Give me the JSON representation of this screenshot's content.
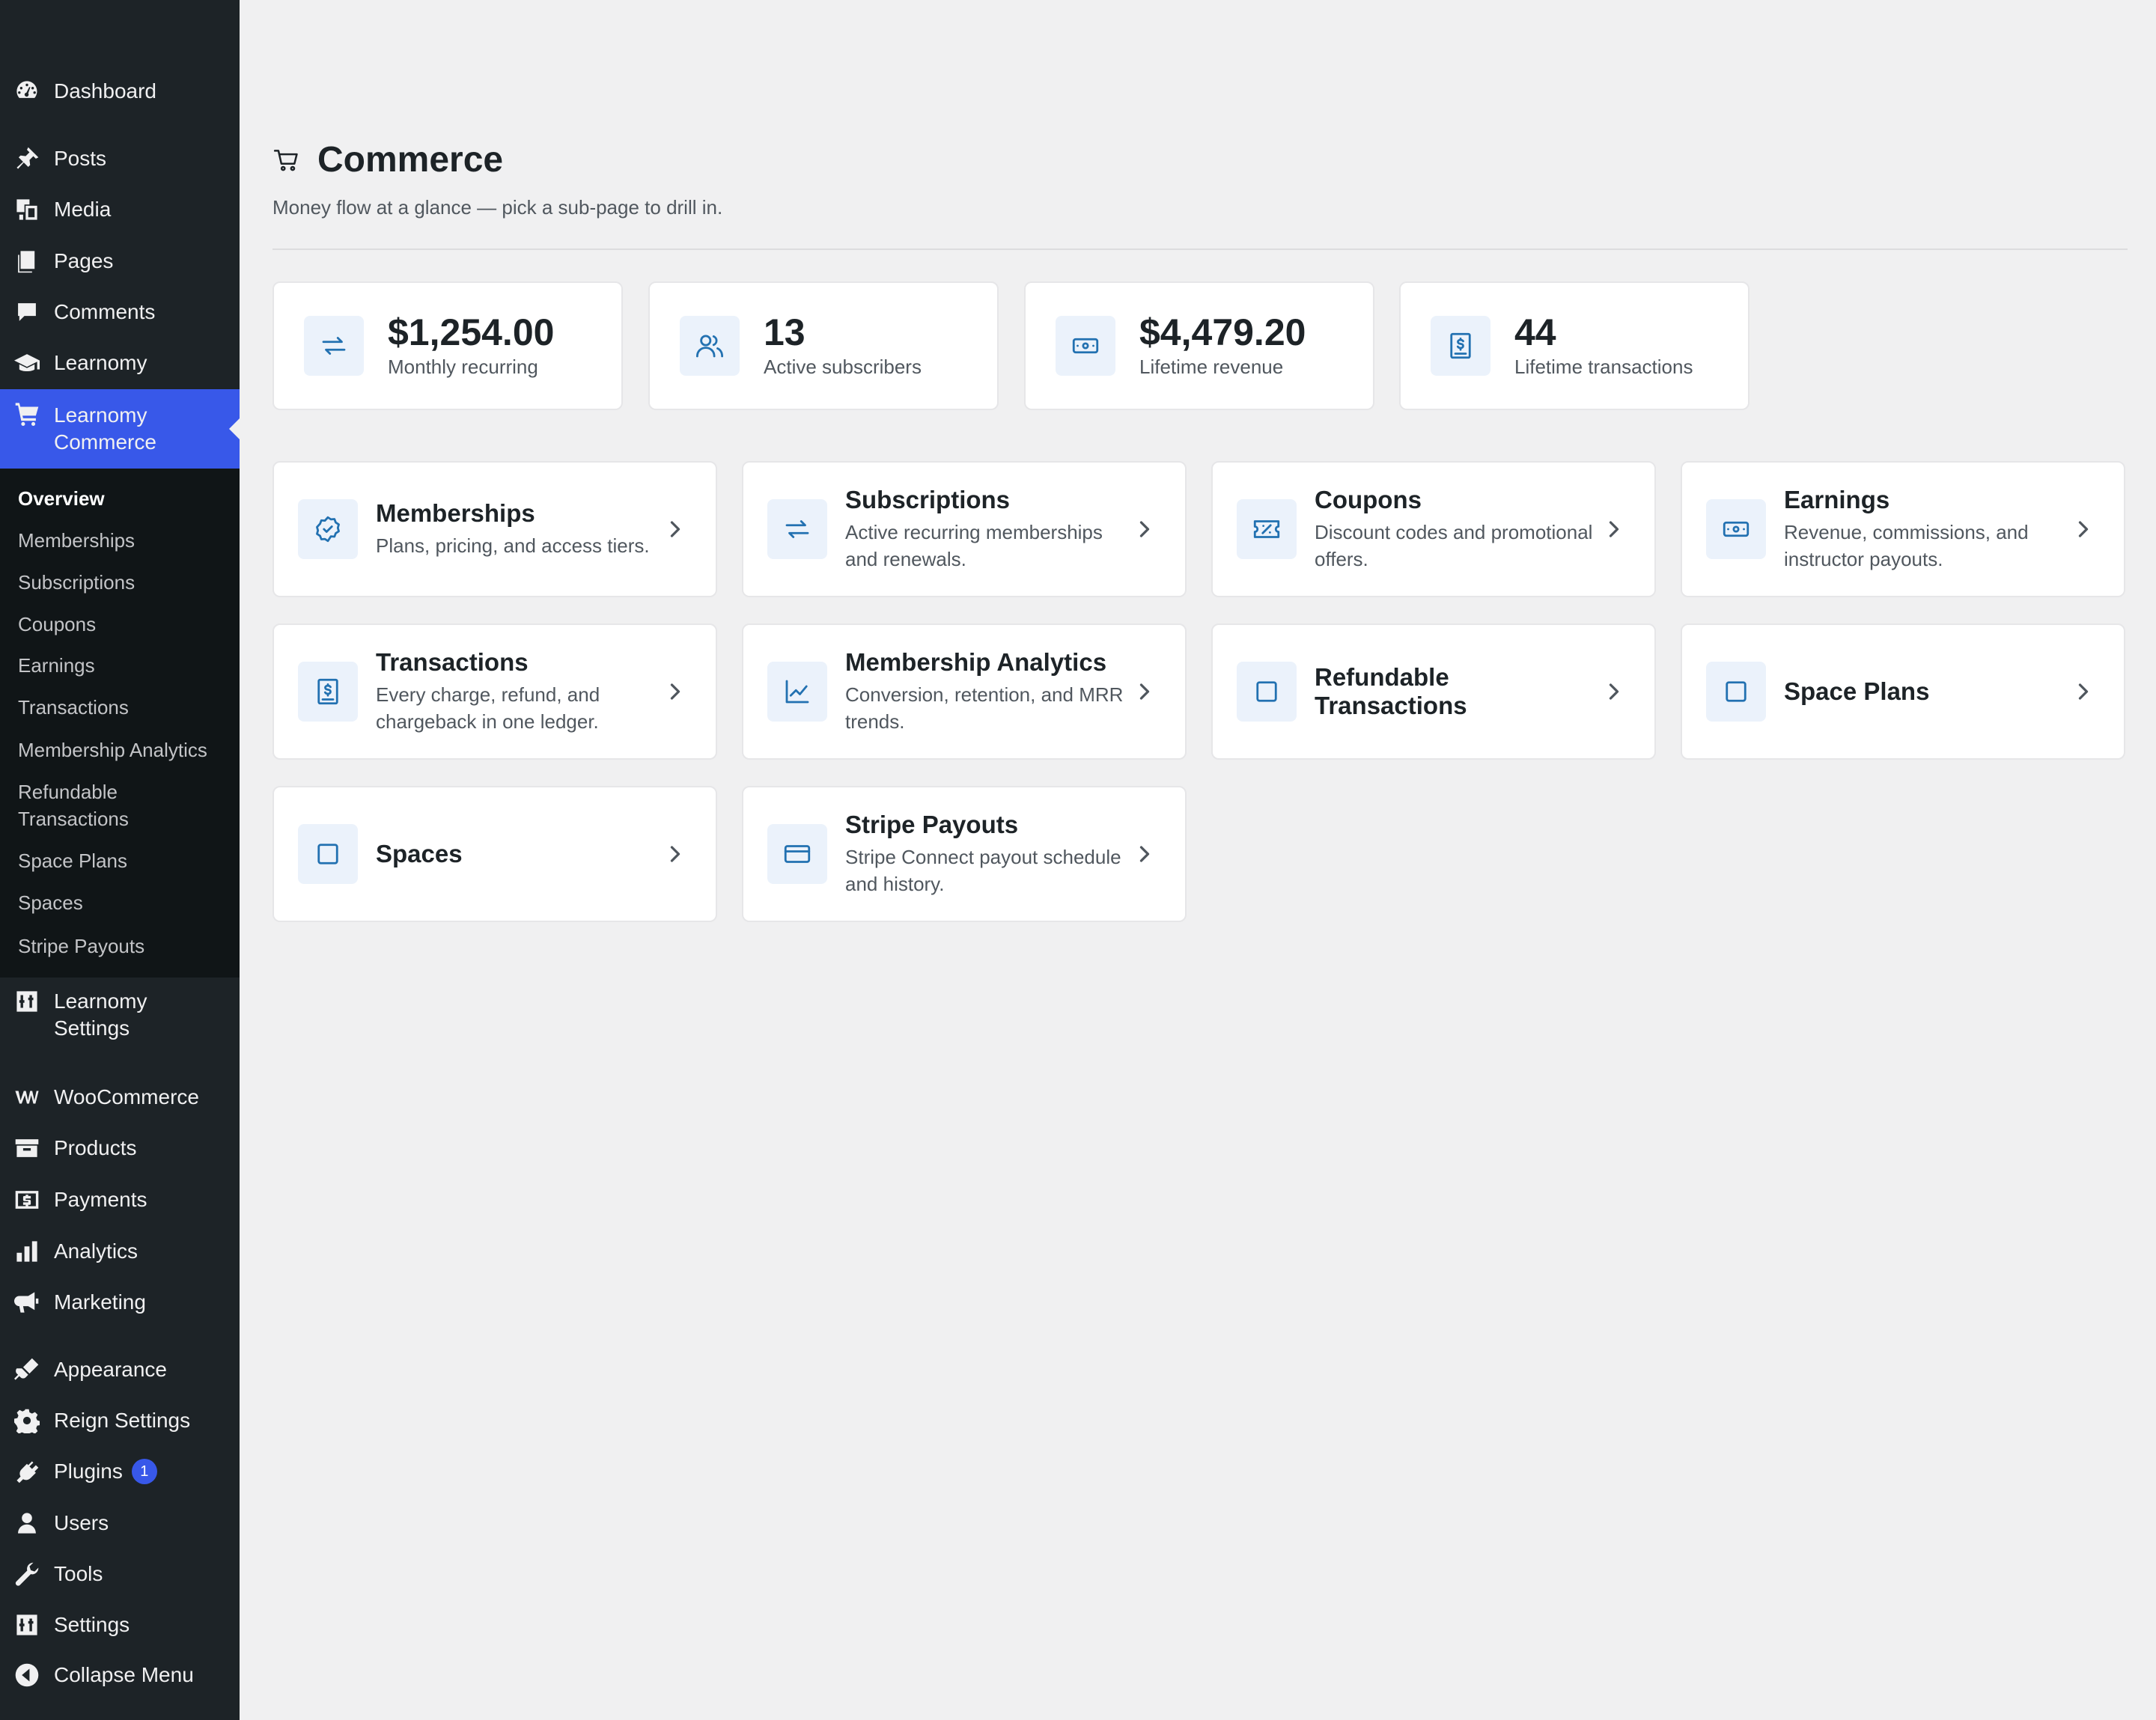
{
  "sidebar": {
    "items": [
      {
        "label": "Dashboard",
        "icon": "dashboard-icon"
      },
      {
        "label": "Posts",
        "icon": "pin-icon"
      },
      {
        "label": "Media",
        "icon": "media-icon"
      },
      {
        "label": "Pages",
        "icon": "pages-icon"
      },
      {
        "label": "Comments",
        "icon": "comments-icon"
      },
      {
        "label": "Learnomy",
        "icon": "graduation-cap-icon"
      },
      {
        "label": "Learnomy Commerce",
        "icon": "cart-icon"
      },
      {
        "label": "Learnomy Settings",
        "icon": "settings-sliders-icon"
      },
      {
        "label": "WooCommerce",
        "icon": "woo-icon"
      },
      {
        "label": "Products",
        "icon": "archive-icon"
      },
      {
        "label": "Payments",
        "icon": "dollar-icon"
      },
      {
        "label": "Analytics",
        "icon": "bar-chart-icon"
      },
      {
        "label": "Marketing",
        "icon": "megaphone-icon"
      },
      {
        "label": "Appearance",
        "icon": "brush-icon"
      },
      {
        "label": "Reign Settings",
        "icon": "gear-icon"
      },
      {
        "label": "Plugins",
        "icon": "plug-icon",
        "badge": "1"
      },
      {
        "label": "Users",
        "icon": "user-icon"
      },
      {
        "label": "Tools",
        "icon": "wrench-icon"
      },
      {
        "label": "Settings",
        "icon": "settings-sliders-icon"
      },
      {
        "label": "Collapse Menu",
        "icon": "collapse-icon"
      }
    ],
    "submenu": [
      "Overview",
      "Memberships",
      "Subscriptions",
      "Coupons",
      "Earnings",
      "Transactions",
      "Membership Analytics",
      "Refundable Transactions",
      "Space Plans",
      "Spaces",
      "Stripe Payouts"
    ]
  },
  "header": {
    "title": "Commerce",
    "subtitle": "Money flow at a glance — pick a sub-page to drill in."
  },
  "stats": [
    {
      "value": "$1,254.00",
      "label": "Monthly recurring",
      "icon": "repeat-icon"
    },
    {
      "value": "13",
      "label": "Active subscribers",
      "icon": "users-icon"
    },
    {
      "value": "$4,479.20",
      "label": "Lifetime revenue",
      "icon": "money-icon"
    },
    {
      "value": "44",
      "label": "Lifetime transactions",
      "icon": "receipt-icon"
    }
  ],
  "cards": [
    {
      "title": "Memberships",
      "desc": "Plans, pricing, and access tiers.",
      "icon": "badge-check-icon"
    },
    {
      "title": "Subscriptions",
      "desc": "Active recurring memberships and renewals.",
      "icon": "repeat-icon"
    },
    {
      "title": "Coupons",
      "desc": "Discount codes and promotional offers.",
      "icon": "ticket-icon"
    },
    {
      "title": "Earnings",
      "desc": "Revenue, commissions, and instructor payouts.",
      "icon": "money-icon"
    },
    {
      "title": "Transactions",
      "desc": "Every charge, refund, and chargeback in one ledger.",
      "icon": "receipt-icon"
    },
    {
      "title": "Membership Analytics",
      "desc": "Conversion, retention, and MRR trends.",
      "icon": "line-chart-icon"
    },
    {
      "title": "Refundable Transactions",
      "desc": "",
      "icon": "square-icon"
    },
    {
      "title": "Space Plans",
      "desc": "",
      "icon": "square-icon"
    },
    {
      "title": "Spaces",
      "desc": "",
      "icon": "square-icon"
    },
    {
      "title": "Stripe Payouts",
      "desc": "Stripe Connect payout schedule and history.",
      "icon": "credit-card-icon"
    }
  ],
  "colors": {
    "accent": "#3858e9",
    "icon": "#2271b1",
    "sidebar": "#1d2327"
  }
}
